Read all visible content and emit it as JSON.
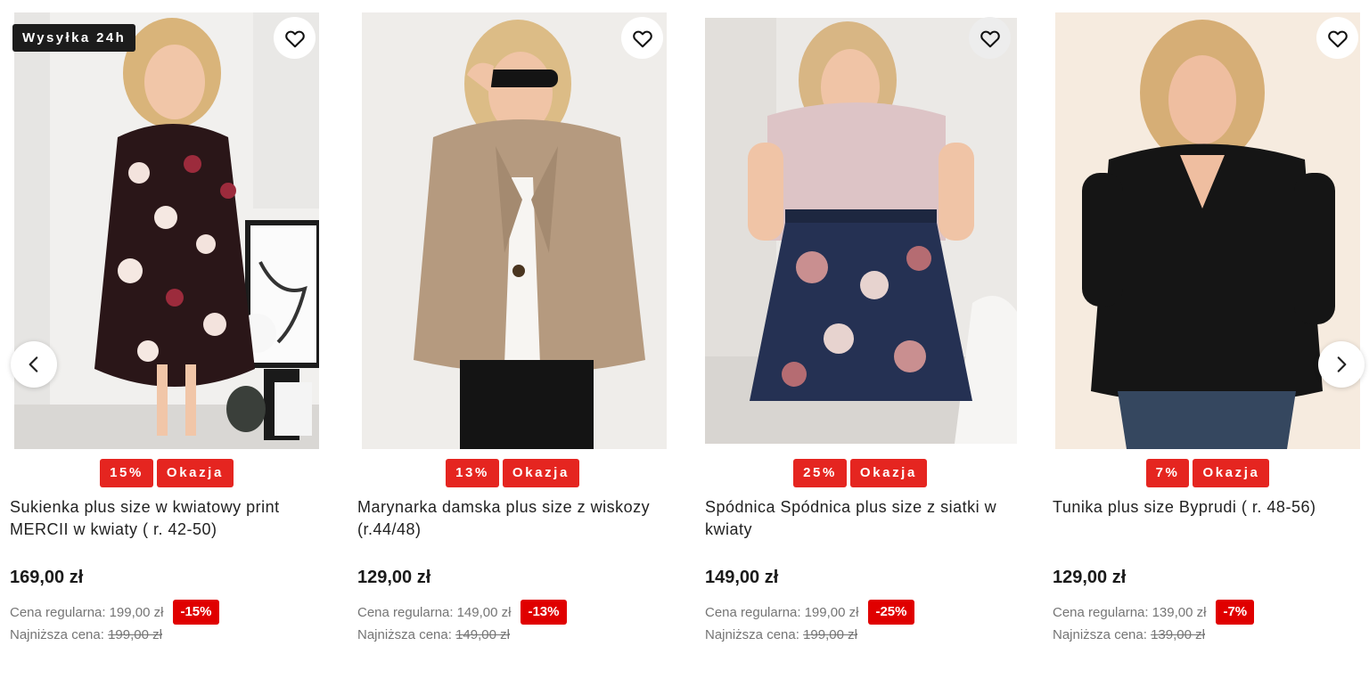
{
  "carousel": {
    "prev_icon": "chevron-left-icon",
    "next_icon": "chevron-right-icon",
    "wishlist_icon": "heart-outline-icon"
  },
  "colors": {
    "sale_badge": "#e52520",
    "discount_tag": "#e00000",
    "shipping_badge": "#1c1c1c"
  },
  "products": [
    {
      "shipping_badge": "Wysyłka 24h",
      "percent_badge": "15%",
      "deal_badge": "Okazja",
      "title": "Sukienka plus size w kwiatowy print MERCII w kwiaty ( r. 42-50)",
      "price": "169,00 zł",
      "regular_label": "Cena regularna:",
      "regular_price": "199,00 zł",
      "discount": "-15%",
      "lowest_label": "Najniższa cena:",
      "lowest_price": "199,00 zł"
    },
    {
      "percent_badge": "13%",
      "deal_badge": "Okazja",
      "title": "Marynarka damska plus size z wiskozy (r.44/48)",
      "price": "129,00 zł",
      "regular_label": "Cena regularna:",
      "regular_price": "149,00 zł",
      "discount": "-13%",
      "lowest_label": "Najniższa cena:",
      "lowest_price": "149,00 zł"
    },
    {
      "percent_badge": "25%",
      "deal_badge": "Okazja",
      "title": "Spódnica Spódnica plus size z siatki w kwiaty",
      "price": "149,00 zł",
      "regular_label": "Cena regularna:",
      "regular_price": "199,00 zł",
      "discount": "-25%",
      "lowest_label": "Najniższa cena:",
      "lowest_price": "199,00 zł"
    },
    {
      "percent_badge": "7%",
      "deal_badge": "Okazja",
      "title": "Tunika plus size Byprudi ( r. 48-56)",
      "price": "129,00 zł",
      "regular_label": "Cena regularna:",
      "regular_price": "139,00 zł",
      "discount": "-7%",
      "lowest_label": "Najniższa cena:",
      "lowest_price": "139,00 zł"
    }
  ]
}
